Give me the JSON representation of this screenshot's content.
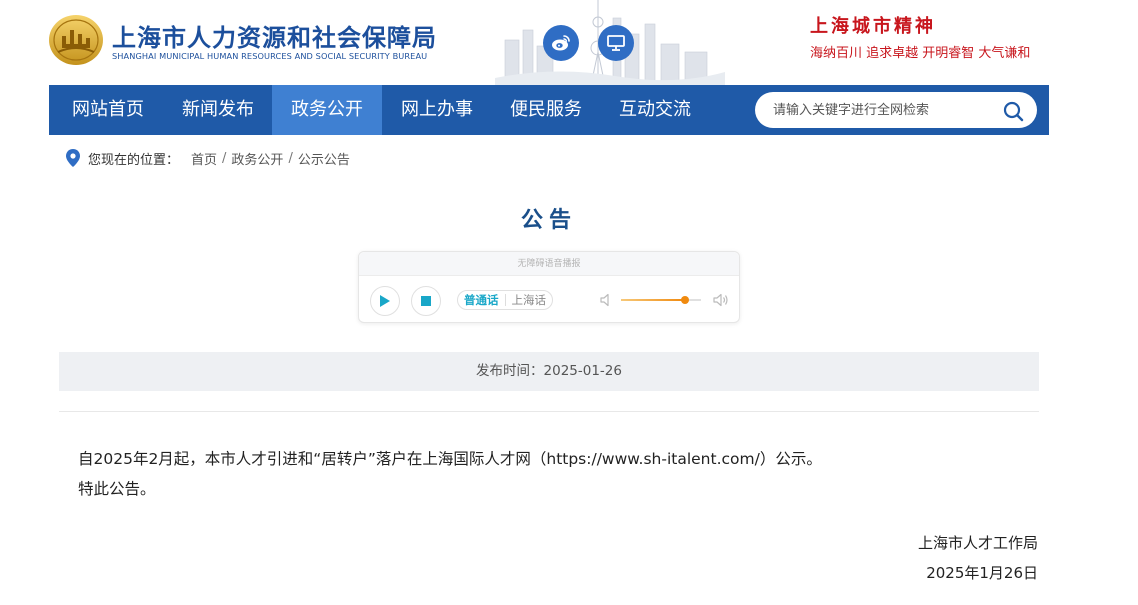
{
  "header": {
    "title": "上海市人力资源和社会保障局",
    "subtitle": "SHANGHAI MUNICIPAL HUMAN RESOURCES AND SOCIAL SECURITY BUREAU",
    "spirit_title": "上海城市精神",
    "spirit_slogan": "海纳百川  追求卓越  开明睿智  大气谦和",
    "icons": {
      "weibo": "weibo-icon",
      "pc": "desktop-icon"
    },
    "colors": {
      "brand_blue": "#1c4f9c",
      "spirit_red": "#c8161d"
    }
  },
  "nav": {
    "items": [
      {
        "label": "网站首页"
      },
      {
        "label": "新闻发布"
      },
      {
        "label": "政务公开",
        "active": true
      },
      {
        "label": "网上办事"
      },
      {
        "label": "便民服务"
      },
      {
        "label": "互动交流"
      }
    ],
    "search_placeholder": "请输入关键字进行全网检索",
    "colors": {
      "bar": "#1f5aa8",
      "active": "#3f80d2"
    }
  },
  "breadcrumb": {
    "label": "您现在的位置：",
    "items": [
      "首页",
      "政务公开",
      "公示公告"
    ],
    "separator": "/"
  },
  "article": {
    "title": "公告",
    "publish_time": "发布时间：2025-01-26",
    "paragraphs": [
      "自2025年2月起，本市人才引进和“居转户”落户在上海国际人才网（https://www.sh-italent.com/）公示。",
      "特此公告。"
    ],
    "signature_org": "上海市人才工作局",
    "signature_date": "2025年1月26日"
  },
  "player": {
    "header": "无障碍语音播报",
    "lang_options": [
      "普通话",
      "上海话"
    ],
    "selected_lang": "普通话",
    "volume": 0.8,
    "accent_color": "#19a7c8",
    "volume_color": "#f08a0f"
  }
}
